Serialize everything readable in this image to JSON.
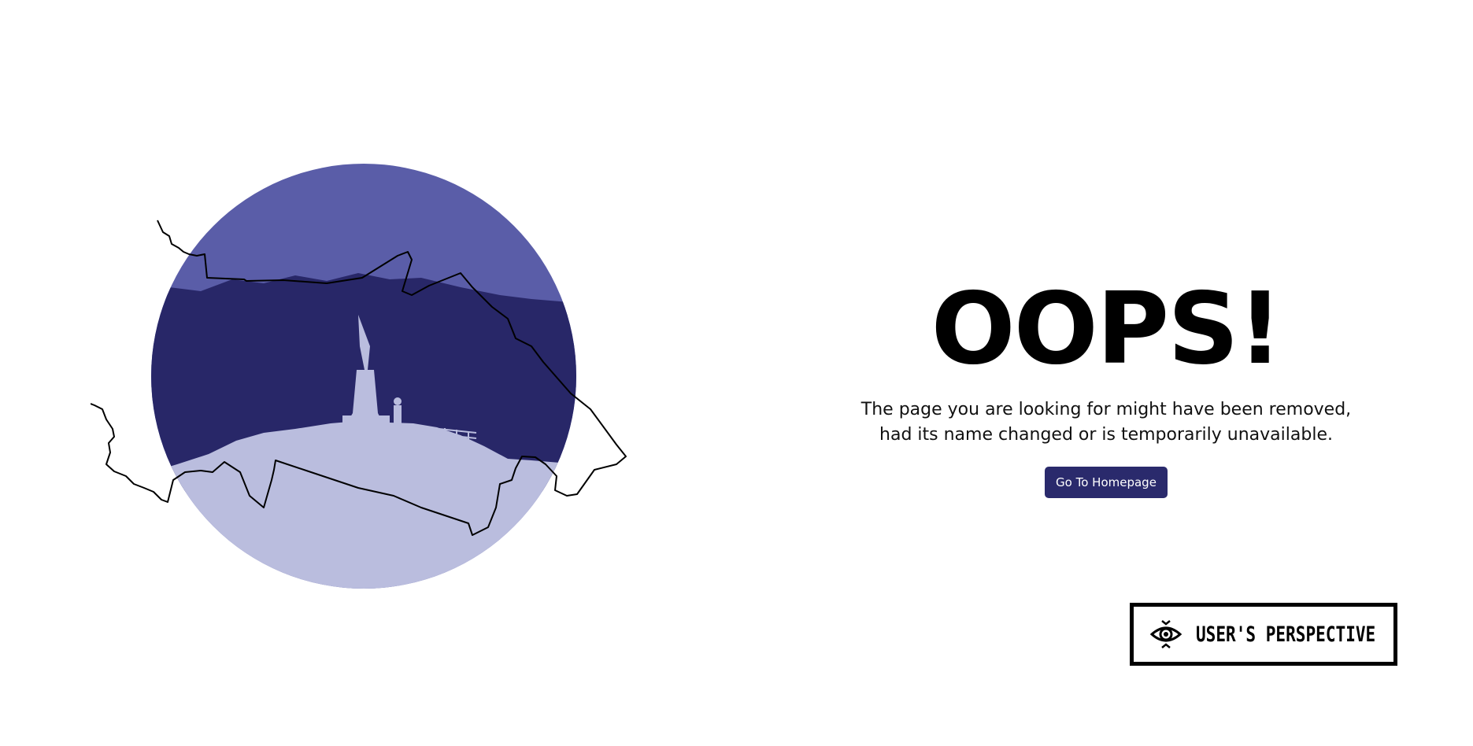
{
  "error": {
    "title": "OOPS!",
    "message": "The page you are looking for might have been removed, had its name changed or is temporarily unavailable.",
    "home_button_label": "Go To Homepage"
  },
  "brand": {
    "name": "USER'S PERSPECTIVE",
    "icon": "eye-icon"
  },
  "illustration": {
    "icon": "ship-illustration",
    "colors": {
      "sky": "#5a5da8",
      "sea": "#282768",
      "deck": "#babdde",
      "outline": "#000000"
    }
  },
  "colors": {
    "accent": "#2a2a6c",
    "text": "#000000",
    "background": "#ffffff"
  }
}
